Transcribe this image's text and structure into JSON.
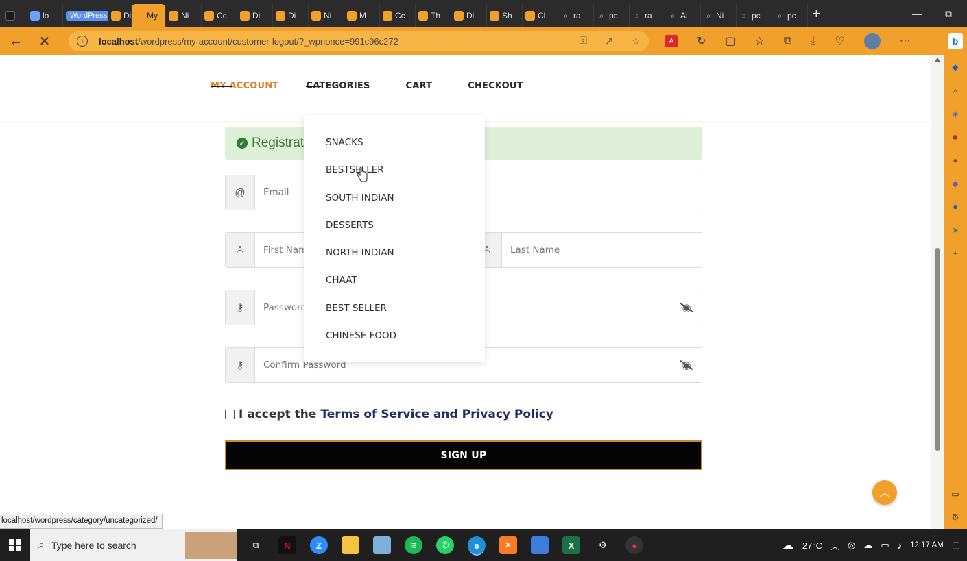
{
  "browser": {
    "tabs": [
      {
        "title": "",
        "kind": "first"
      },
      {
        "title": "lo",
        "kind": "wp"
      },
      {
        "title": "WordPress",
        "kind": "badge"
      },
      {
        "title": "Di",
        "kind": "site"
      },
      {
        "title": "My",
        "kind": "site",
        "active": true
      },
      {
        "title": "Ni",
        "kind": "site"
      },
      {
        "title": "Cc",
        "kind": "site"
      },
      {
        "title": "Di",
        "kind": "site"
      },
      {
        "title": "Di",
        "kind": "site"
      },
      {
        "title": "Ni",
        "kind": "site"
      },
      {
        "title": "M",
        "kind": "site"
      },
      {
        "title": "Cc",
        "kind": "site"
      },
      {
        "title": "Th",
        "kind": "site"
      },
      {
        "title": "Di",
        "kind": "site"
      },
      {
        "title": "Sh",
        "kind": "site"
      },
      {
        "title": "Cl",
        "kind": "site"
      },
      {
        "title": "ra",
        "kind": "search"
      },
      {
        "title": "pc",
        "kind": "search"
      },
      {
        "title": "ra",
        "kind": "search"
      },
      {
        "title": "Ai",
        "kind": "search"
      },
      {
        "title": "Ni",
        "kind": "search"
      },
      {
        "title": "pc",
        "kind": "search"
      },
      {
        "title": "pc",
        "kind": "search"
      }
    ],
    "active_tab_close": "✕",
    "new_tab": "+",
    "url_host": "localhost",
    "url_rest": "/wordpress/my-account/customer-logout/?_wpnonce=991c96c272",
    "accent": "#f0a02b"
  },
  "nav": {
    "my_account": "MY ACCOUNT",
    "categories": "CATEGORIES",
    "cart": "CART",
    "checkout": "CHECKOUT"
  },
  "notice": {
    "text": "Registrat"
  },
  "form": {
    "email_placeholder": "Email",
    "first_name_placeholder": "First Name",
    "last_name_placeholder": "Last Name",
    "password_placeholder": "Password",
    "confirm_password_placeholder": "Confirm Password",
    "terms_prefix": "I accept the",
    "terms_link": "Terms of Service and Privacy Policy",
    "signup_label": "SIGN UP"
  },
  "categories_menu": [
    "SNACKS",
    "BESTSELLER",
    "SOUTH INDIAN",
    "DESSERTS",
    "NORTH INDIAN",
    "CHAAT",
    "BEST SELLER",
    "CHINESE FOOD"
  ],
  "status_bar_url": "localhost/wordpress/category/uncategorized/",
  "taskbar": {
    "search_placeholder": "Type here to search",
    "weather": "27°C",
    "time": "12:17 AM",
    "date": ""
  }
}
